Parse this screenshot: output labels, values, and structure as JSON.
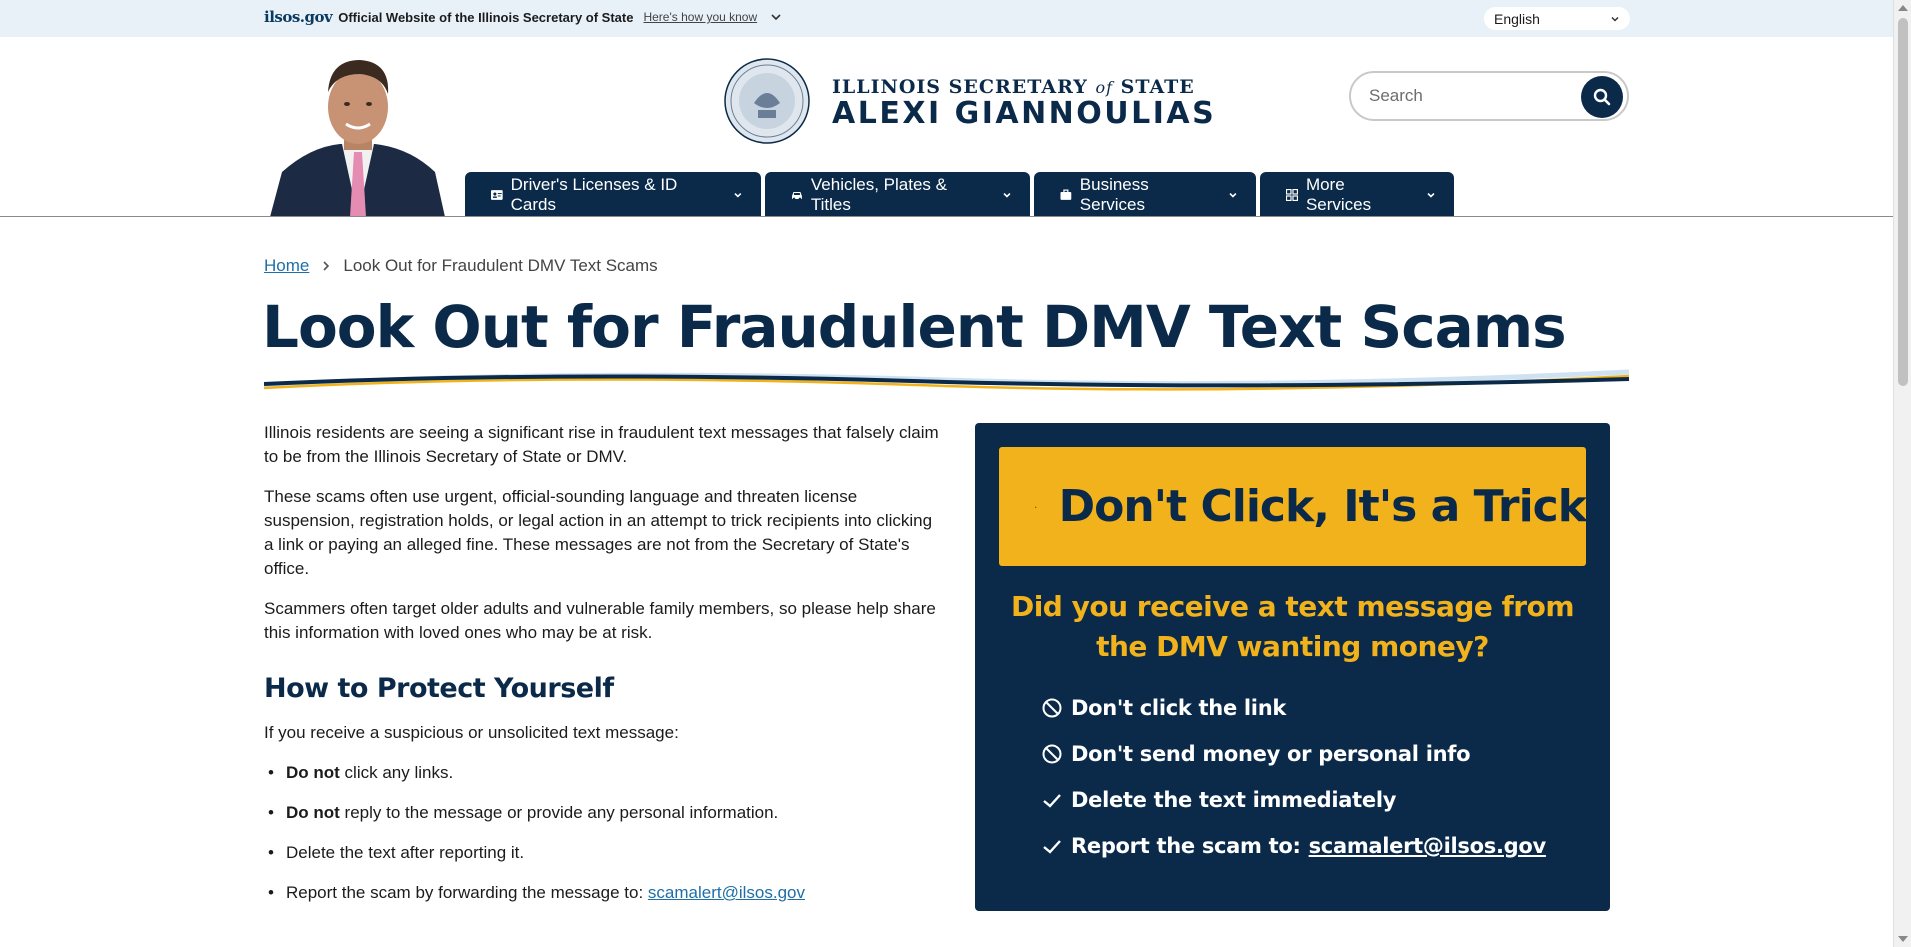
{
  "gov_banner": {
    "logo_text": "ilsos.gov",
    "official_text": "Official Website of the Illinois Secretary of State",
    "how_link": "Here's how you know",
    "language": "English"
  },
  "header": {
    "brand_line1_prefix": "ILLINOIS SECRETARY ",
    "brand_line1_of": "of",
    "brand_line1_suffix": " STATE",
    "brand_line2": "ALEXI GIANNOULIAS",
    "search_placeholder": "Search"
  },
  "nav": [
    {
      "label": "Driver's Licenses & ID Cards",
      "icon": "id-card-icon"
    },
    {
      "label": "Vehicles, Plates & Titles",
      "icon": "car-icon"
    },
    {
      "label": "Business Services",
      "icon": "briefcase-icon"
    },
    {
      "label": "More Services",
      "icon": "grid-icon"
    }
  ],
  "breadcrumb": {
    "home": "Home",
    "current": "Look Out for Fraudulent DMV Text Scams"
  },
  "page_title": "Look Out for Fraudulent DMV Text Scams",
  "content": {
    "p1": "Illinois residents are seeing a significant rise in fraudulent text messages that falsely claim to be from the Illinois Secretary of State or DMV.",
    "p2": "These scams often use urgent, official-sounding language and threaten license suspension, registration holds, or legal action in an attempt to trick recipients into clicking a link or paying an alleged fine. These messages are not from the Secretary of State's office.",
    "p3": "Scammers often target older adults and vulnerable family members, so please help share this information with loved ones who may be at risk.",
    "h2": "How to Protect Yourself",
    "intro": "If you receive a suspicious or unsolicited text message:",
    "bullets": [
      {
        "bold": "Do not",
        "rest": " click any links."
      },
      {
        "bold": "Do not",
        "rest": " reply to the message or provide any personal information."
      },
      {
        "bold": "",
        "rest": "Delete the text after reporting it."
      },
      {
        "bold": "",
        "rest": "Report the scam by forwarding the message to: ",
        "link": "scamalert@ilsos.gov"
      }
    ]
  },
  "card": {
    "banner": "Don't Click, It's a Trick",
    "question": "Did you receive a text message from the DMV wanting money?",
    "tips": [
      {
        "icon": "prohibited-icon",
        "text": "Don't click the link"
      },
      {
        "icon": "prohibited-icon",
        "text": "Don't send money or personal info"
      },
      {
        "icon": "checkmark-icon",
        "text": "Delete the text immediately"
      },
      {
        "icon": "checkmark-icon",
        "text": "Report the scam to: ",
        "link": "scamalert@ilsos.gov"
      }
    ]
  },
  "colors": {
    "navy": "#0b2a4a",
    "gold": "#f2b21b",
    "link": "#1e6fa8",
    "banner_bg": "#e8f1f8"
  }
}
